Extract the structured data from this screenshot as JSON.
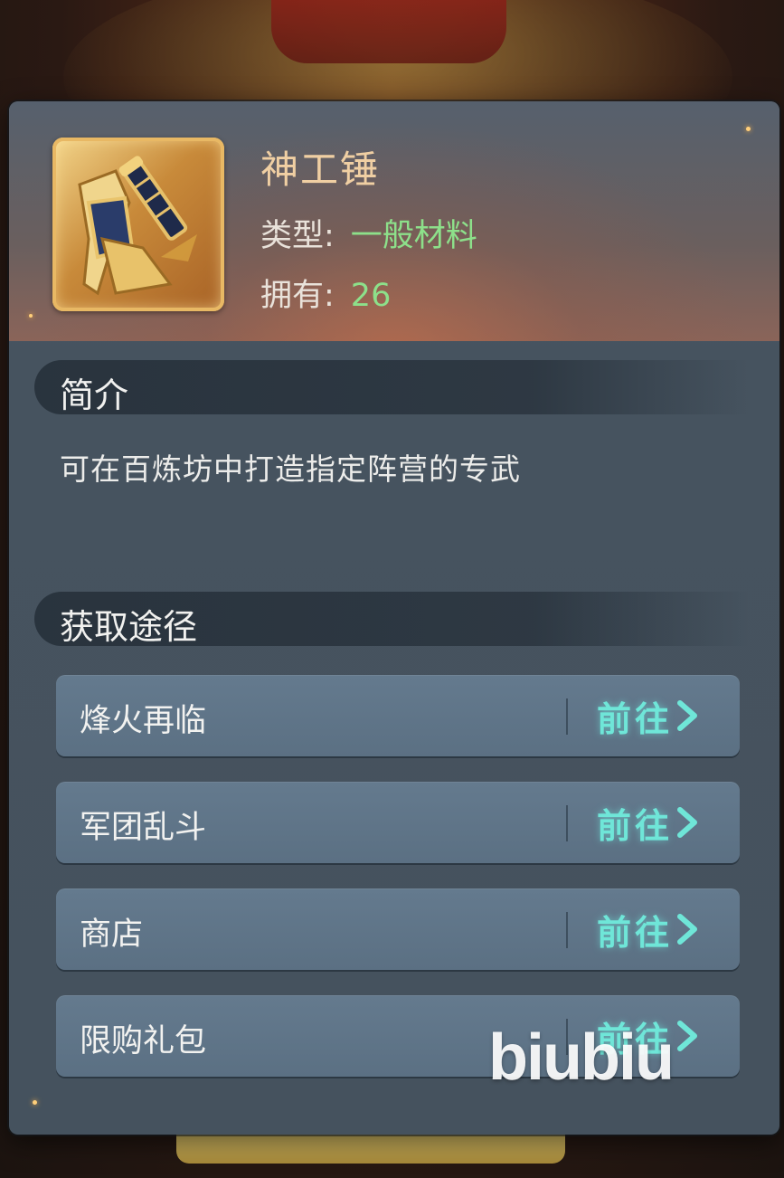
{
  "item": {
    "name": "神工锤",
    "type_label": "类型:",
    "type_value": "一般材料",
    "own_label": "拥有:",
    "own_value": "26",
    "icon": "hammer-icon"
  },
  "intro": {
    "title": "简介",
    "text": "可在百炼坊中打造指定阵营的专武"
  },
  "sources": {
    "title": "获取途径",
    "go_label": "前往",
    "items": [
      {
        "label": "烽火再临"
      },
      {
        "label": "军团乱斗"
      },
      {
        "label": "商店"
      },
      {
        "label": "限购礼包"
      }
    ]
  },
  "watermark": "biubiu",
  "colors": {
    "accent_teal": "#6fe6d8",
    "value_green": "#8de08a",
    "name_gold": "#f0cfa3"
  }
}
